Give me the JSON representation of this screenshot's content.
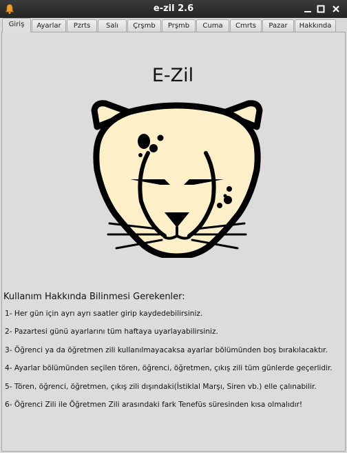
{
  "window": {
    "title": "e-zil 2.6",
    "app_icon": "bell-icon",
    "controls": [
      "minimize-icon",
      "maximize-icon",
      "close-icon"
    ]
  },
  "tabs": [
    {
      "label": "Giriş",
      "active": true
    },
    {
      "label": "Ayarlar",
      "active": false
    },
    {
      "label": "Pzrts",
      "active": false
    },
    {
      "label": "Salı",
      "active": false
    },
    {
      "label": "Çrşmb",
      "active": false
    },
    {
      "label": "Prşmb",
      "active": false
    },
    {
      "label": "Cuma",
      "active": false
    },
    {
      "label": "Cmrts",
      "active": false
    },
    {
      "label": "Pazar",
      "active": false
    },
    {
      "label": "Hakkında",
      "active": false
    }
  ],
  "main": {
    "heading": "E-Zil",
    "logo": "cheetah-logo",
    "info_title": "Kullanım Hakkında Bilinmesi Gerekenler:",
    "info_items": [
      "1- Her gün için ayrı ayrı saatler girip kaydedebilirsiniz.",
      "2- Pazartesi günü ayarlarını tüm haftaya uyarlayabilirsiniz.",
      "3- Öğrenci ya da öğretmen zili kullanılmayacaksa ayarlar bölümünden boş bırakılacaktır.",
      "4- Ayarlar bölümünden seçilen tören, öğrenci, öğretmen, çıkış zili tüm günlerde geçerlidir.",
      "5- Tören, öğrenci, öğretmen, çıkış zili dışındaki(İstiklal Marşı, Siren vb.) elle çalınabilir.",
      "6- Öğrenci Zili ile Öğretmen Zili arasındaki fark Tenefüs süresinden kısa olmalıdır!"
    ]
  },
  "colors": {
    "titlebar": "#2f2f2f",
    "bell": "#f0a030",
    "logo_fill": "#fdf0c8",
    "logo_stroke": "#000000"
  }
}
